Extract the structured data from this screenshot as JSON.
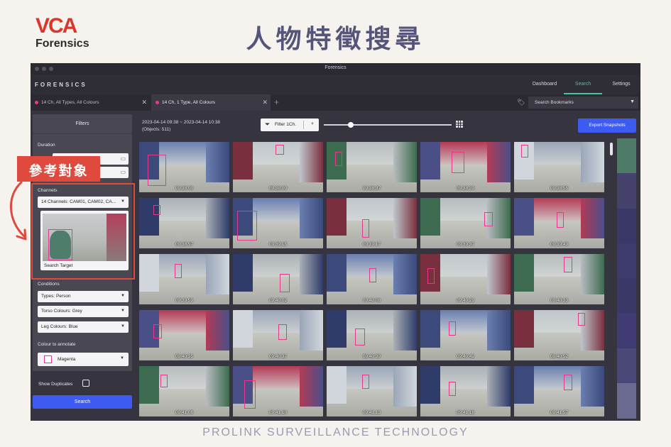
{
  "branding": {
    "logo_mark": "VCA",
    "logo_sub": "Forensics",
    "headline": "人物特徵搜尋",
    "footer": "PROLINK SURVEILLANCE TECHNOLOGY",
    "colors": {
      "brand_red": "#d9372b",
      "headline": "#55557a"
    }
  },
  "window": {
    "title": "Forensics"
  },
  "menubar": {
    "brand": "FORENSICS",
    "nav": [
      "Dashboard",
      "Search",
      "Settings"
    ],
    "active": "Search"
  },
  "tabs": [
    {
      "label": "14 Ch, All Types, All Colours"
    },
    {
      "label": "14 Ch, 1 Type, All Colours"
    }
  ],
  "tab_add": "+",
  "bookmarks": {
    "placeholder": "Search Bookmarks",
    "icon": "tag-icon"
  },
  "sidebar": {
    "title": "Filters",
    "duration_label": "Duration",
    "channels_label": "Channels",
    "channels_value": "14 Channels: CAM01, CAM02, CA...",
    "target_label": "Search Target",
    "conditions_label": "Conditions",
    "conditions": [
      "Types: Person",
      "Torso Colours: Grey",
      "Leg Colours: Blue"
    ],
    "colour_label": "Colour to annotate",
    "colour_value": "Magenta",
    "duplicates_label": "Show Duplicates",
    "search_button": "Search"
  },
  "annotation": {
    "badge": "參考對象",
    "color": "#e0493e"
  },
  "main": {
    "range_line1": "2023-04-14 09:38 ~ 2023-04-14 10:38",
    "range_line2": "(Objects: 511)",
    "filter_button": "Filter 1Ch.",
    "export_button": "Export Snapshots",
    "accent": "#3d5af1",
    "highlight": "#e6388f"
  },
  "timestamps": [
    "09:38:00",
    "09:38:00",
    "09:38:37",
    "09:38:39",
    "09:38:55",
    "09:38:57",
    "09:39:15",
    "09:39:17",
    "09:39:37",
    "09:39:49",
    "09:39:59",
    "09:40:02",
    "09:40:08",
    "09:40:29",
    "09:40:33",
    "09:40:35",
    "09:40:37",
    "09:40:39",
    "09:40:42",
    "09:40:52",
    "09:41:06",
    "09:41:10",
    "09:41:13",
    "09:41:18",
    "09:41:57"
  ],
  "timeline_colors": [
    "#4e7a68",
    "#44416a",
    "#3a3868",
    "#3d3a6e",
    "#3a3868",
    "#403c73",
    "#4a4878",
    "#6a6a90"
  ]
}
